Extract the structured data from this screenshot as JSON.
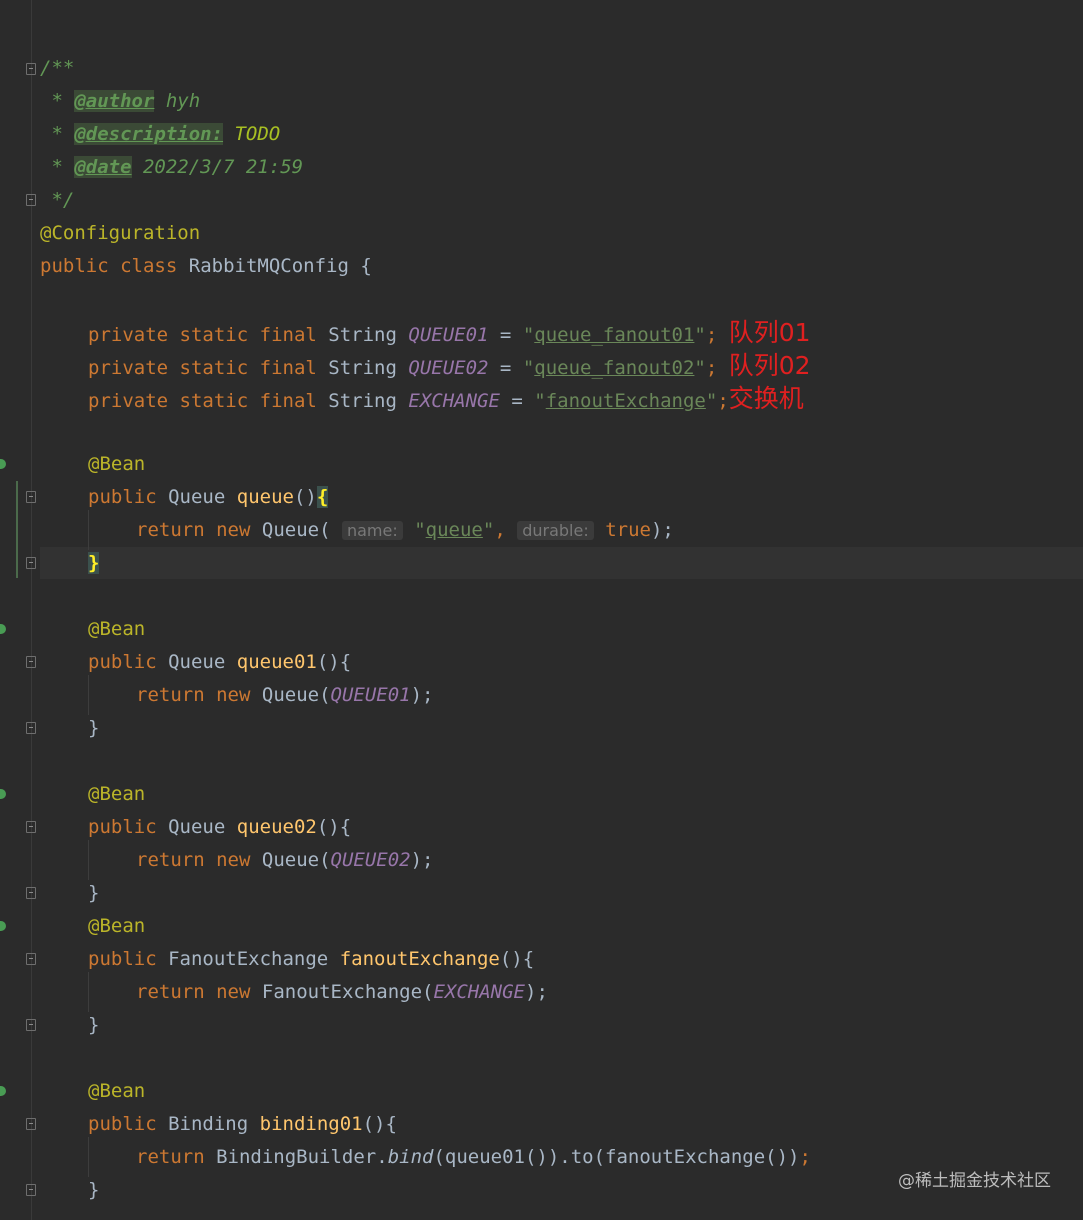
{
  "code": {
    "doc_open": "/**",
    "doc_author_prefix": " * ",
    "doc_author_tag": "@author",
    "doc_author_value": " hyh",
    "doc_desc_prefix": " * ",
    "doc_desc_tag": "@description:",
    "doc_desc_value": " TODO",
    "doc_date_prefix": " * ",
    "doc_date_tag": "@date",
    "doc_date_value": " 2022/3/7 21:59",
    "doc_close": " */",
    "annotation_config": "@Configuration",
    "kw_public": "public",
    "kw_class": "class",
    "class_name": "RabbitMQConfig",
    "brace_open": "{",
    "brace_close": "}",
    "kw_private": "private",
    "kw_static": "static",
    "kw_final": "final",
    "type_string": "String",
    "const_q1": "QUEUE01",
    "const_q2": "QUEUE02",
    "const_ex": "EXCHANGE",
    "equals": "=",
    "quote": "\"",
    "semicolon": ";",
    "str_q1": "queue_fanout01",
    "str_q2": "queue_fanout02",
    "str_ex": "fanoutExchange",
    "note_q1": "队列01",
    "note_q2": "队列02",
    "note_ex": "交换机",
    "annotation_bean": "@Bean",
    "type_queue": "Queue",
    "fn_queue": "queue",
    "parens_brace": "(){",
    "paren_open": "(",
    "paren_close_semi": ");",
    "kw_return": "return",
    "kw_new": "new",
    "hint_name": "name:",
    "str_queue": "queue",
    "comma": ",",
    "hint_durable": "durable:",
    "kw_true": "true",
    "fn_queue01": "queue01",
    "fn_queue02": "queue02",
    "type_fanout": "FanoutExchange",
    "fn_fanout": "fanoutExchange",
    "type_binding": "Binding",
    "fn_binding01": "binding01",
    "binding_builder": "BindingBuilder.",
    "static_bind": "bind",
    "binding_tail": "(queue01()).to(fanoutExchange())",
    "space": " "
  },
  "watermark": "@稀土掘金技术社区"
}
